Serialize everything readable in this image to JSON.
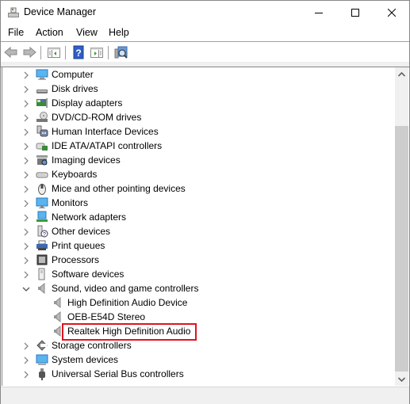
{
  "window": {
    "title": "Device Manager",
    "controls": [
      "minimize",
      "maximize",
      "close"
    ]
  },
  "menu": [
    "File",
    "Action",
    "View",
    "Help"
  ],
  "toolbar": {
    "buttons": [
      {
        "name": "back",
        "icon": "back-arrow-icon"
      },
      {
        "name": "forward",
        "icon": "forward-arrow-icon"
      },
      {
        "name": "show-hide-console-tree",
        "icon": "console-tree-icon"
      },
      {
        "name": "help",
        "icon": "help-icon"
      },
      {
        "name": "show-hide-action-pane",
        "icon": "action-pane-icon"
      },
      {
        "name": "scan-hardware-changes",
        "icon": "scan-hardware-icon"
      }
    ]
  },
  "tree": {
    "items": [
      {
        "label": "Computer",
        "icon": "computer-icon",
        "level": 0,
        "expanded": false
      },
      {
        "label": "Disk drives",
        "icon": "disk-drive-icon",
        "level": 0,
        "expanded": false
      },
      {
        "label": "Display adapters",
        "icon": "display-adapter-icon",
        "level": 0,
        "expanded": false
      },
      {
        "label": "DVD/CD-ROM drives",
        "icon": "dvd-drive-icon",
        "level": 0,
        "expanded": false
      },
      {
        "label": "Human Interface Devices",
        "icon": "hid-icon",
        "level": 0,
        "expanded": false
      },
      {
        "label": "IDE ATA/ATAPI controllers",
        "icon": "ide-controller-icon",
        "level": 0,
        "expanded": false
      },
      {
        "label": "Imaging devices",
        "icon": "camera-icon",
        "level": 0,
        "expanded": false
      },
      {
        "label": "Keyboards",
        "icon": "keyboard-icon",
        "level": 0,
        "expanded": false
      },
      {
        "label": "Mice and other pointing devices",
        "icon": "mouse-icon",
        "level": 0,
        "expanded": false
      },
      {
        "label": "Monitors",
        "icon": "monitor-icon",
        "level": 0,
        "expanded": false
      },
      {
        "label": "Network adapters",
        "icon": "network-adapter-icon",
        "level": 0,
        "expanded": false
      },
      {
        "label": "Other devices",
        "icon": "unknown-device-icon",
        "level": 0,
        "expanded": false
      },
      {
        "label": "Print queues",
        "icon": "printer-icon",
        "level": 0,
        "expanded": false
      },
      {
        "label": "Processors",
        "icon": "processor-icon",
        "level": 0,
        "expanded": false
      },
      {
        "label": "Software devices",
        "icon": "software-device-icon",
        "level": 0,
        "expanded": false
      },
      {
        "label": "Sound, video and game controllers",
        "icon": "speaker-icon",
        "level": 0,
        "expanded": true
      },
      {
        "label": "High Definition Audio Device",
        "icon": "speaker-icon",
        "level": 1
      },
      {
        "label": "OEB-E54D Stereo",
        "icon": "speaker-icon",
        "level": 1
      },
      {
        "label": "Realtek High Definition Audio",
        "icon": "speaker-icon",
        "level": 1,
        "highlighted": true
      },
      {
        "label": "Storage controllers",
        "icon": "storage-controller-icon",
        "level": 0,
        "expanded": false
      },
      {
        "label": "System devices",
        "icon": "system-device-icon",
        "level": 0,
        "expanded": false
      },
      {
        "label": "Universal Serial Bus controllers",
        "icon": "usb-icon",
        "level": 0,
        "expanded": false
      }
    ]
  },
  "colors": {
    "highlight_border": "#e0141e",
    "scroll_thumb": "#cdcdcd",
    "chrome": "#f0f0f0"
  }
}
